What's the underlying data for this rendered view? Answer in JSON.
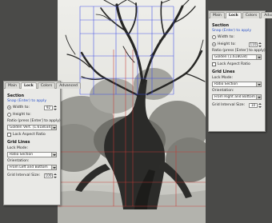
{
  "left_palette": {
    "tabs": [
      "Main",
      "Lock",
      "Colors",
      "Advanced"
    ],
    "active_tab": "Lock",
    "section_title": "Section",
    "snap_link": "Snap (Enter) to apply",
    "width_label": "Width to:",
    "width_value": "92",
    "height_label": "Height to:",
    "height_value": "",
    "ratio_label": "Ratio (press [Enter] to apply)",
    "ratio_value": "Golden Vert. (1.618034)",
    "lock_aspect_label": "Lock Aspect Ratio",
    "grid_lines_title": "Grid Lines",
    "lock_mode_label": "Lock Mode:",
    "lock_mode_value": "Ratio Section",
    "orientation_label": "Orientation:",
    "orientation_value": "From Left and Bottom",
    "grid_interval_label": "Grid Interval Size:",
    "grid_interval_value": "100"
  },
  "right_palette": {
    "tabs": [
      "Main",
      "Lock",
      "Colors",
      "Advanced"
    ],
    "active_tab": "Lock",
    "section_title": "Section",
    "snap_link": "Snap (Enter) to apply",
    "width_label": "Width to:",
    "width_value": "",
    "height_label": "Height to:",
    "height_value": "110",
    "ratio_label": "Ratio (press [Enter] to apply)",
    "ratio_value": "Golden (1.618034)",
    "lock_aspect_label": "Lock Aspect Ratio",
    "grid_lines_title": "Grid Lines",
    "lock_mode_label": "Lock Mode:",
    "lock_mode_value": "Ratio Section",
    "orientation_label": "Orientation:",
    "orientation_value": "From Right and Bottom",
    "grid_interval_label": "Grid Interval Size:",
    "grid_interval_value": "10"
  },
  "overlay_colors": {
    "blue_grid": "#3a49e6",
    "red_grid": "#c73a35"
  }
}
